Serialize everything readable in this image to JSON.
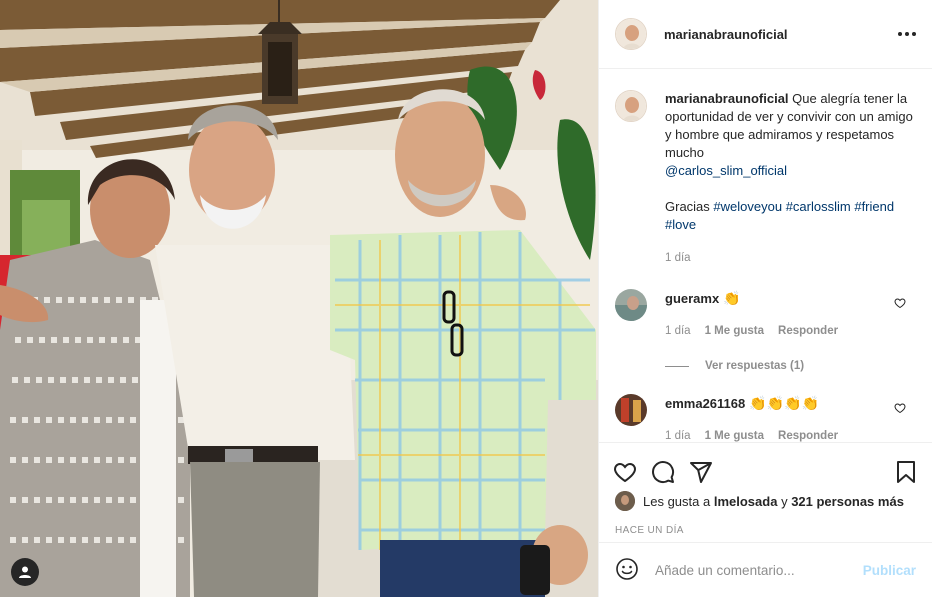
{
  "post": {
    "photo_description": "Tres personas posando sonrientes bajo un porche",
    "tag_icon": "user-tag-icon"
  },
  "header": {
    "username": "marianabraunoficial",
    "more_icon": "more-options-icon"
  },
  "caption": {
    "username": "marianabraunoficial",
    "text": "Que alegría tener la oportunidad de ver y convivir con un amigo y hombre que admiramos y respetamos mucho",
    "mention": "@carlos_slim_official",
    "gracias": "Gracias",
    "hashtags": [
      "#weloveyou",
      "#carlosslim",
      "#friend",
      "#love"
    ],
    "time": "1 día"
  },
  "comments": [
    {
      "username": "gueramx",
      "emoji": "👏",
      "time": "1 día",
      "likes": "1 Me gusta",
      "reply": "Responder",
      "view_replies": "Ver respuestas (1)"
    },
    {
      "username": "emma261168",
      "emoji": "👏👏👏👏",
      "time": "1 día",
      "likes": "1 Me gusta",
      "reply": "Responder"
    }
  ],
  "actions": {
    "like_icon": "heart-icon",
    "comment_icon": "comment-icon",
    "share_icon": "share-icon",
    "save_icon": "bookmark-icon"
  },
  "likes": {
    "prefix": "Les gusta a",
    "user": "lmelosada",
    "connector": "y",
    "others": "321 personas más"
  },
  "posted_ago": "HACE UN DÍA",
  "composer": {
    "placeholder": "Añade un comentario...",
    "publish": "Publicar",
    "emoji_icon": "emoji-icon"
  },
  "colors": {
    "link": "#00376b",
    "muted": "#8e8e8e",
    "publish_disabled": "#b2dffc"
  }
}
